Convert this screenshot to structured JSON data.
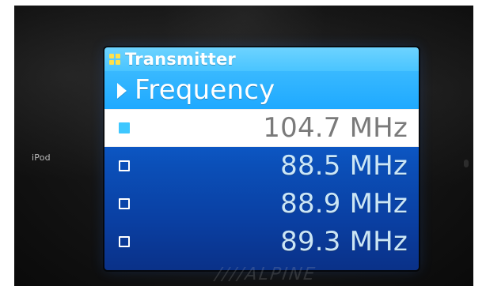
{
  "device": {
    "side_label": "iPod",
    "brand_text": "////ALPINE"
  },
  "screen": {
    "title": "Transmitter",
    "menu_item": "Frequency",
    "frequencies": [
      {
        "value": "104.7 MHz",
        "selected": true
      },
      {
        "value": "88.5 MHz",
        "selected": false
      },
      {
        "value": "88.9 MHz",
        "selected": false
      },
      {
        "value": "89.3 MHz",
        "selected": false
      }
    ]
  },
  "colors": {
    "title_bar": "#49C4FF",
    "menu_bar": "#1EA9FF",
    "selected_row": "#FFFFFF",
    "list_gradient_top": "#0E66DA",
    "list_gradient_bottom": "#0A3188",
    "marker_selected": "#3EC7FF",
    "menu_icon": "#FFE14A"
  },
  "icons": {
    "title_icon": "grid-icon",
    "menu_icon": "play-right-icon",
    "row_marker": "checkbox-square-icon"
  }
}
